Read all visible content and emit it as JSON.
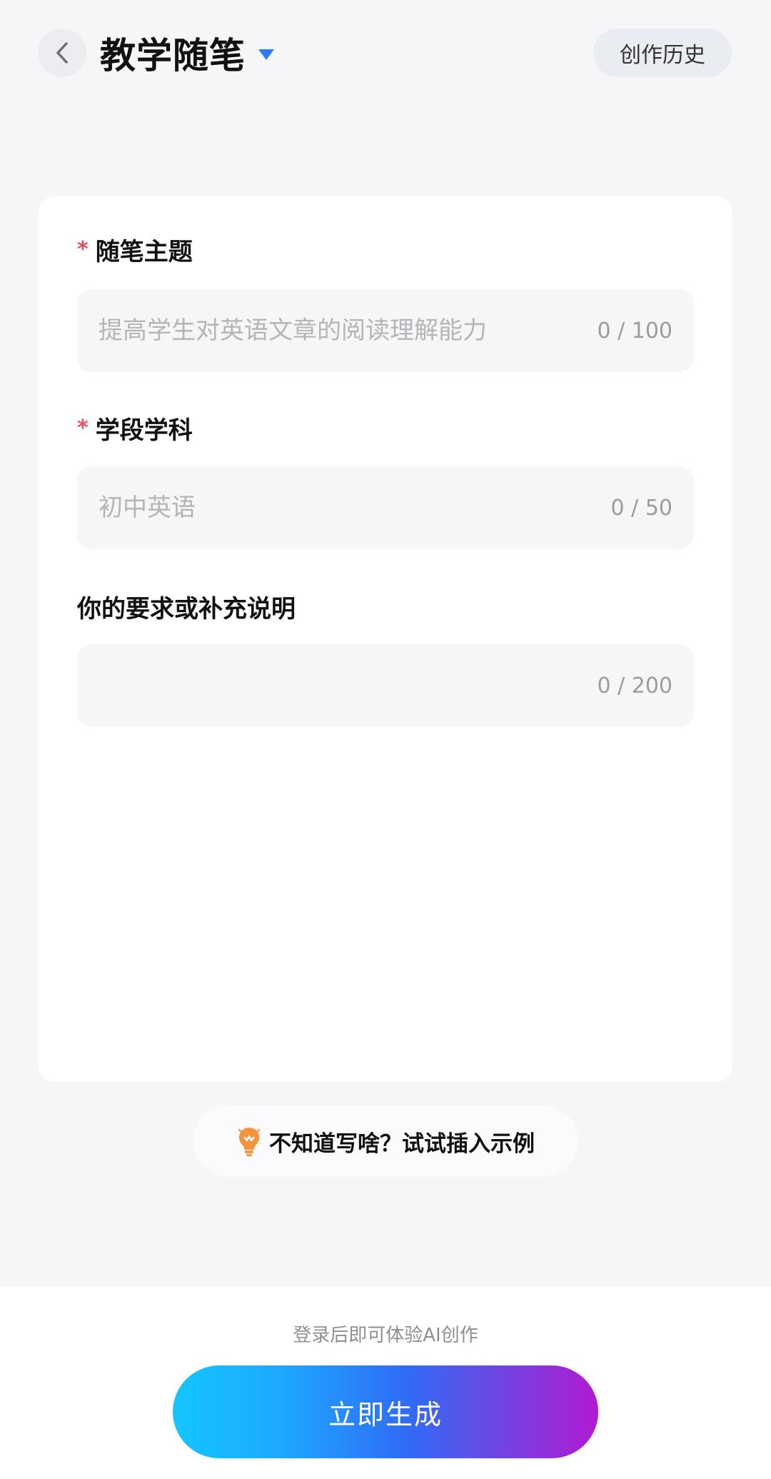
{
  "header": {
    "title": "教学随笔",
    "history_label": "创作历史"
  },
  "form": {
    "fields": [
      {
        "label": "随笔主题",
        "required": true,
        "value": "",
        "placeholder": "提高学生对英语文章的阅读理解能力",
        "counter": "0 / 100"
      },
      {
        "label": "学段学科",
        "required": true,
        "value": "",
        "placeholder": "初中英语",
        "counter": "0 / 50"
      },
      {
        "label": "你的要求或补充说明",
        "required": false,
        "value": "",
        "placeholder": "",
        "counter": "0 / 200"
      }
    ],
    "required_mark": "*"
  },
  "hint": {
    "text": "不知道写啥？试试插入示例"
  },
  "footer": {
    "login_tip": "登录后即可体验AI创作",
    "generate_label": "立即生成"
  },
  "colors": {
    "accent_blue": "#2b7cf6",
    "required_red": "#ef4b5c",
    "gradient_start": "#13c6ff",
    "gradient_end": "#b11ad1",
    "bulb_orange": "#f5943a"
  },
  "icons": {
    "back": "chevron-left-icon",
    "dropdown": "caret-down-icon",
    "hint": "lightbulb-icon"
  }
}
